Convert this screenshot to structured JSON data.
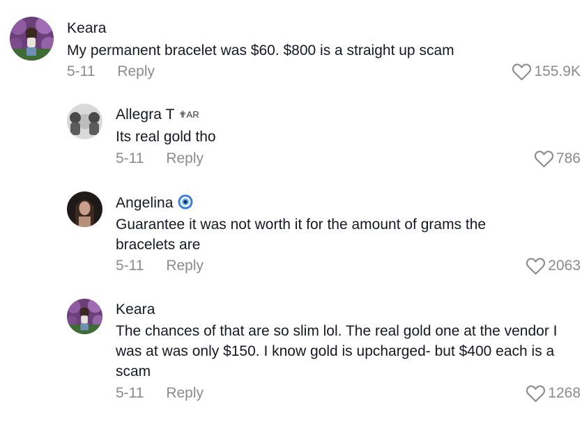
{
  "comments": [
    {
      "username": "Keara",
      "badge": "",
      "text": "My permanent bracelet was $60. $800 is a straight up scam",
      "date": "5-11",
      "reply_label": "Reply",
      "likes": "155.9K"
    },
    {
      "username": "Allegra T",
      "badge": "✟AR",
      "text": "Its real gold tho",
      "date": "5-11",
      "reply_label": "Reply",
      "likes": "786"
    },
    {
      "username": "Angelina",
      "badge_icon": "evil-eye-icon",
      "text": "Guarantee it was not worth it for the amount of grams the bracelets are",
      "date": "5-11",
      "reply_label": "Reply",
      "likes": "2063"
    },
    {
      "username": "Keara",
      "badge": "",
      "text": "The chances of that are so slim lol. The real gold one at the vendor I was at was only $150. I know gold is upcharged- but $400 each is a scam",
      "date": "5-11",
      "reply_label": "Reply",
      "likes": "1268"
    }
  ],
  "colors": {
    "text": "#161823",
    "muted": "#8a8b91",
    "heart_outline": "#8a8b91"
  },
  "icons": {
    "like": "heart-outline-icon"
  }
}
